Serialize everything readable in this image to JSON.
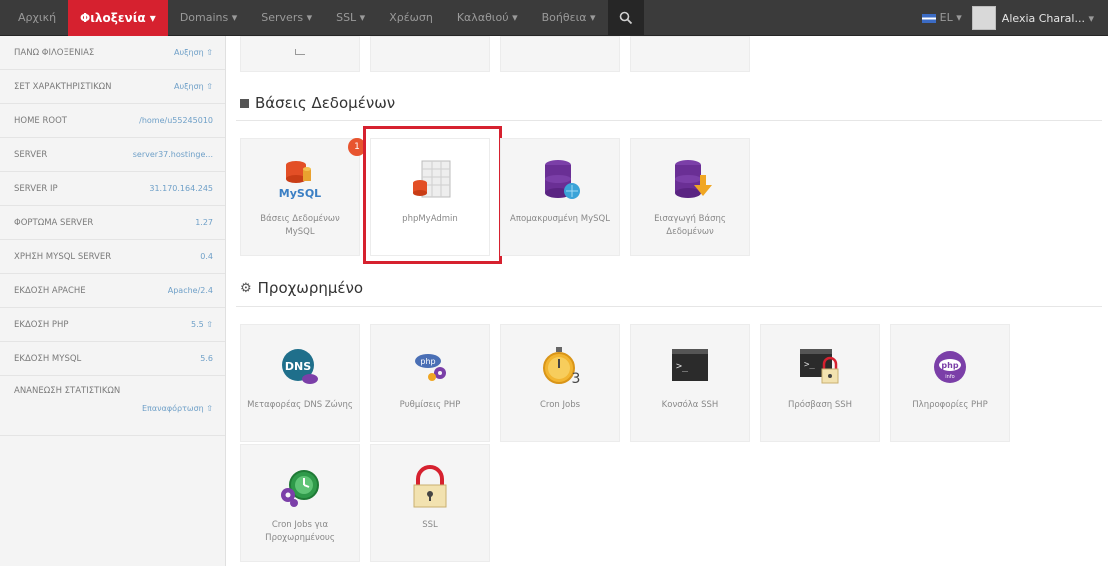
{
  "topnav": {
    "items": [
      {
        "label": "Αρχική"
      },
      {
        "label": "Φιλοξενία ▾"
      },
      {
        "label": "Domains ▾"
      },
      {
        "label": "Servers ▾"
      },
      {
        "label": "SSL ▾"
      },
      {
        "label": "Χρέωση"
      },
      {
        "label": "Καλαθιού ▾"
      },
      {
        "label": "Βοήθεια ▾"
      }
    ],
    "language": "EL",
    "user": "Alexia Charal..."
  },
  "sidebar": {
    "rows": [
      {
        "label": "ΠΑΝΩ ΦΙΛΟΞΕΝΙΑΣ",
        "value": "Αυξηση ⇧"
      },
      {
        "label": "ΣΕΤ ΧΑΡΑΚΤΗΡΙΣΤΙΚΩΝ",
        "value": "Αυξηση ⇧"
      },
      {
        "label": "HOME ROOT",
        "value": "/home/u55245010"
      },
      {
        "label": "SERVER",
        "value": "server37.hostinge..."
      },
      {
        "label": "SERVER IP",
        "value": "31.170.164.245"
      },
      {
        "label": "ΦΟΡΤΩΜΑ SERVER",
        "value": "1.27"
      },
      {
        "label": "ΧΡΗΣΗ MYSQL SERVER",
        "value": "0.4"
      },
      {
        "label": "ΕΚΔΟΣΗ APACHE",
        "value": "Apache/2.4"
      },
      {
        "label": "ΕΚΔΟΣΗ PHP",
        "value": "5.5 ⇧"
      },
      {
        "label": "ΕΚΔΟΣΗ MYSQL",
        "value": "5.6"
      }
    ],
    "stats": {
      "label": "ΑΝΑΝΕΩΣΗ ΣΤΑΤΙΣΤΙΚΩΝ",
      "value": "Επαναφόρτωση ⇧"
    }
  },
  "databases": {
    "title": "Βάσεις Δεδομένων",
    "badge": "1",
    "tiles": [
      {
        "label": "Βάσεις Δεδομένων MySQL",
        "icon": "mysql-db-icon"
      },
      {
        "label": "phpMyAdmin",
        "icon": "phpmyadmin-icon"
      },
      {
        "label": "Απομακρυσμένη MySQL",
        "icon": "remote-mysql-icon"
      },
      {
        "label": "Εισαγωγή Βάσης Δεδομένων",
        "icon": "import-db-icon"
      }
    ]
  },
  "advanced": {
    "title": "Προχωρημένο",
    "tiles": [
      {
        "label": "Μεταφορέας DNS Ζώνης",
        "icon": "dns-icon"
      },
      {
        "label": "Ρυθμίσεις PHP",
        "icon": "php-settings-icon"
      },
      {
        "label": "Cron Jobs",
        "icon": "stopwatch-icon"
      },
      {
        "label": "Κονσόλα SSH",
        "icon": "terminal-icon"
      },
      {
        "label": "Πρόσβαση SSH",
        "icon": "ssh-access-icon"
      },
      {
        "label": "Πληροφορίες PHP",
        "icon": "php-info-icon"
      },
      {
        "label": "Cron Jobs για Προχωρημένους",
        "icon": "advanced-cron-icon"
      },
      {
        "label": "SSL",
        "icon": "padlock-icon"
      }
    ]
  },
  "colors": {
    "accent": "#d6212f",
    "navbar": "#3b3b3b",
    "sidebar": "#f4f4f4",
    "tile": "#f5f5f5"
  }
}
